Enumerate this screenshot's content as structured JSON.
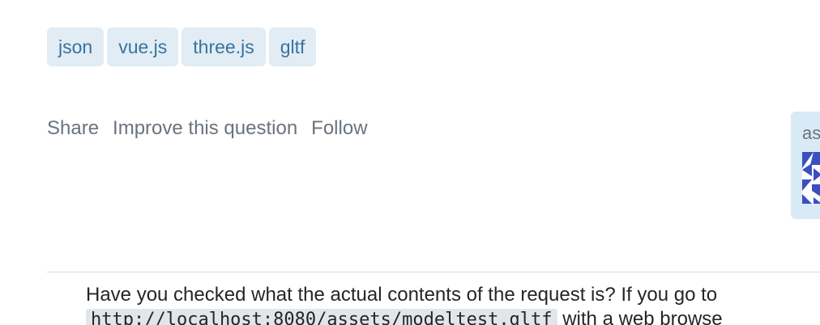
{
  "tags": [
    "json",
    "vue.js",
    "three.js",
    "gltf"
  ],
  "post_menu": {
    "share": "Share",
    "improve": "Improve this question",
    "follow": "Follow"
  },
  "user_card": {
    "asked_label": "as",
    "avatar_icon": "identicon-icon"
  },
  "comment": {
    "line1": "Have you checked what the actual contents of the request is? If you go to",
    "code": "http://localhost:8080/assets/modeltest.gltf",
    "line2_tail": " with a web browse"
  },
  "colors": {
    "tag_bg": "#e1ecf4",
    "tag_text": "#39739d",
    "menu_text": "#6a737c",
    "card_bg": "#d9eaf7",
    "avatar": "#3a4fc0"
  }
}
